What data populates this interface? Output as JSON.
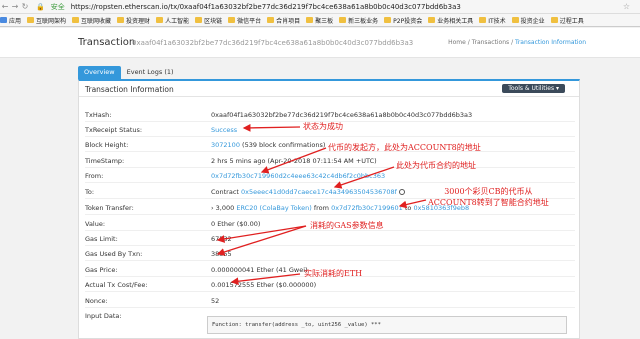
{
  "browser": {
    "security": "安全",
    "url": "https://ropsten.etherscan.io/tx/0xaaf04f1a63032bf2be77dc36d219f7bc4ce638a61a8b0b0c40d3c077bdd6b3a3",
    "bookmarks": [
      "应用",
      "互联网架构",
      "互联网收藏",
      "投资理财",
      "人工智能",
      "区块链",
      "微信平台",
      "合肖项目",
      "聚三板",
      "新三板业务",
      "P2P投资会",
      "业务相关工具",
      "IT技术",
      "投资企业",
      "过程工具"
    ]
  },
  "header": {
    "title": "Transaction",
    "hash": "0xaaf04f1a63032bf2be77dc36d219f7bc4ce638a61a8b0b0c40d3c077bdd6b3a3",
    "breadcrumb": {
      "home": "Home",
      "sep1": "/",
      "transactions": "Transactions",
      "sep2": "/",
      "current": "Transaction Information"
    }
  },
  "tabs": {
    "overview": "Overview",
    "events": "Event Logs (1)"
  },
  "panel": {
    "title": "Transaction Information",
    "tools": "Tools & Utilities ▾",
    "rows": {
      "txhash": {
        "label": "TxHash:",
        "value": "0xaaf04f1a63032bf2be77dc36d219f7bc4ce638a61a8b0b0c40d3c077bdd6b3a3"
      },
      "status": {
        "label": "TxReceipt Status:",
        "value": "Success"
      },
      "block": {
        "label": "Block Height:",
        "value": "3072100",
        "extra": "(539 block confirmations)"
      },
      "time": {
        "label": "TimeStamp:",
        "value": "2 hrs 5 mins ago (Apr-20-2018 07:11:54 AM +UTC)"
      },
      "from": {
        "label": "From:",
        "value": "0x7d72fb30c719960d2c4eee63c42c4db6f2c0bbc363"
      },
      "to": {
        "label": "To:",
        "prefix": "Contract",
        "value": "0x5eeec41d0dd7caece17c4a34963504536708f"
      },
      "token": {
        "label": "Token Transfer:",
        "amount": "› 3,000",
        "token": "ERC20 (ColaBay Token)",
        "from_word": "from",
        "from": "0x7d72fb30c7199601",
        "to_word": "to",
        "to": "0x5810363f9eb8"
      },
      "value": {
        "label": "Value:",
        "value": "0 Ether ($0.00)"
      },
      "gaslimit": {
        "label": "Gas Limit:",
        "value": "67532"
      },
      "gasused": {
        "label": "Gas Used By Txn:",
        "value": "38355"
      },
      "gasprice": {
        "label": "Gas Price:",
        "value": "0.000000041 Ether (41 Gwei)"
      },
      "cost": {
        "label": "Actual Tx Cost/Fee:",
        "value": "0.001572555 Ether ($0.000000)"
      },
      "nonce": {
        "label": "Nonce:",
        "value": "52"
      },
      "input": {
        "label": "Input Data:",
        "value": "Function: transfer(address _to, uint256 _value) ***"
      }
    }
  },
  "annotations": {
    "status": "状态为成功",
    "from": "代币的发起方，此处为ACCOUNT8的地址",
    "to": "此处为代币合约的地址",
    "token_line1": "3000个彩贝CB的代币从",
    "token_line2": "ACCOUNT8转到了智能合约地址",
    "gas": "消耗的GAS参数信息",
    "eth": "实际消耗的ETH"
  },
  "colors": {
    "accent": "#3498db",
    "annotation": "#e02020"
  }
}
